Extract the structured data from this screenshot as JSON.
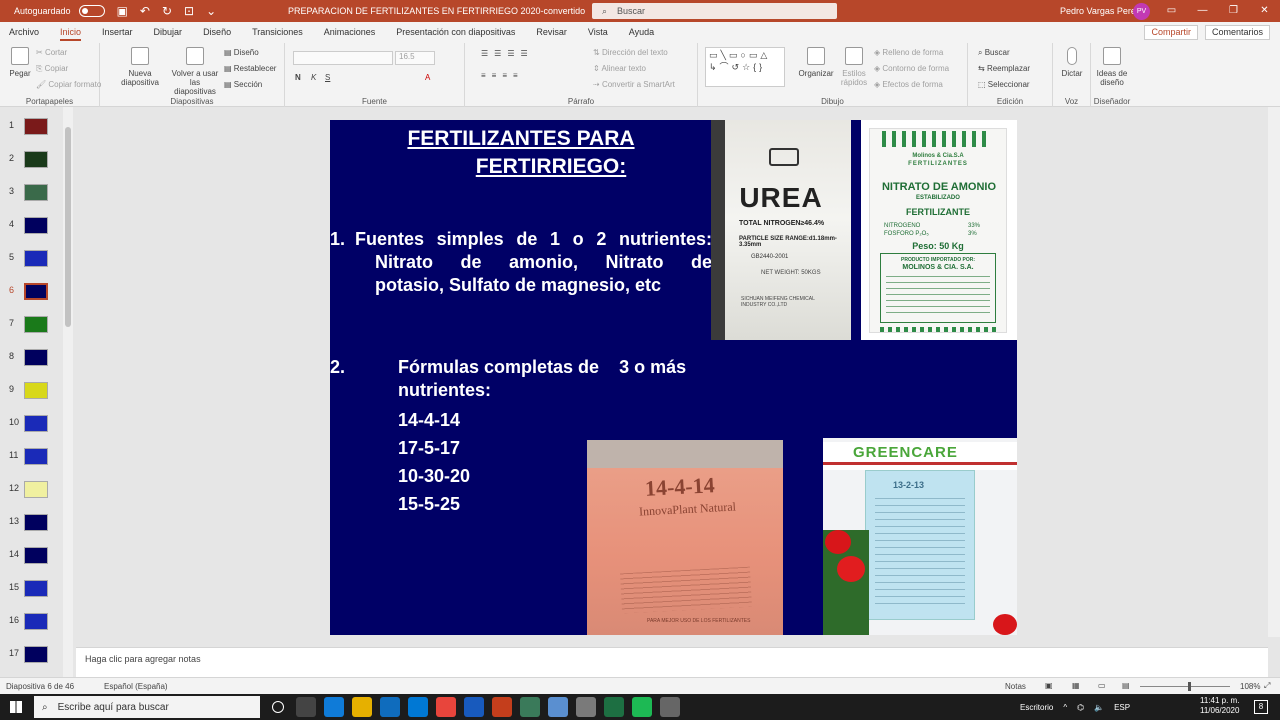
{
  "titlebar": {
    "autosave_label": "Autoguardado",
    "document_title": "PREPARACION DE FERTILIZANTES EN FERTIRRIEGO 2020-convertido",
    "search_placeholder": "Buscar",
    "user_name": "Pedro Vargas Perez",
    "user_initials": "PV"
  },
  "menu": {
    "tabs": [
      "Archivo",
      "Inicio",
      "Insertar",
      "Dibujar",
      "Diseño",
      "Transiciones",
      "Animaciones",
      "Presentación con diapositivas",
      "Revisar",
      "Vista",
      "Ayuda"
    ],
    "active": "Inicio",
    "share_label": "Compartir",
    "comments_label": "Comentarios"
  },
  "ribbon": {
    "portapapeles": {
      "label": "Portapapeles",
      "pegar": "Pegar",
      "cortar": "Cortar",
      "copiar": "Copiar",
      "copiar_formato": "Copiar formato"
    },
    "diapositivas": {
      "label": "Diapositivas",
      "nueva": "Nueva diapositiva",
      "volver": "Volver a usar las diapositivas",
      "diseno": "Diseño",
      "restablecer": "Restablecer",
      "seccion": "Sección"
    },
    "fuente": {
      "label": "Fuente",
      "size": "16.5",
      "n": "N",
      "k": "K",
      "s": "S"
    },
    "parrafo": {
      "label": "Párrafo",
      "direccion": "Dirección del texto",
      "alinear": "Alinear texto",
      "smartart": "Convertir a SmartArt"
    },
    "dibujo": {
      "label": "Dibujo",
      "organizar": "Organizar",
      "estilos": "Estilos rápidos",
      "relleno": "Relleno de forma",
      "contorno": "Contorno de forma",
      "efectos": "Efectos de forma"
    },
    "edicion": {
      "label": "Edición",
      "buscar": "Buscar",
      "reemplazar": "Reemplazar",
      "seleccionar": "Seleccionar"
    },
    "voz": {
      "label": "Voz",
      "dictar": "Dictar"
    },
    "disenador": {
      "label": "Diseñador",
      "ideas": "Ideas de diseño"
    }
  },
  "thumbnails": [
    "1",
    "2",
    "3",
    "4",
    "5",
    "6",
    "7",
    "8",
    "9",
    "10",
    "11",
    "12",
    "13",
    "14",
    "15",
    "16",
    "17"
  ],
  "selected_slide": "6",
  "slide": {
    "title_line1": "FERTILIZANTES PARA",
    "title_line2": "FERTIRRIEGO:",
    "item1_num": "1.",
    "item1_line1": "Fuentes simples de 1 o 2 nutrientes:",
    "item1_line2": "Nitrato de amonio, Nitrato de",
    "item1_line3": "potasio, Sulfato de magnesio, etc",
    "item2_num": "2.",
    "item2_text": "Fórmulas completas de    3 o más nutrientes:",
    "formulas": [
      "14-4-14",
      "17-5-17",
      "10-30-20",
      "15-5-25"
    ],
    "urea_bag": {
      "word": "UREA",
      "total": "TOTAL NITROGEN≥46.4%",
      "particle": "PARTICLE SIZE RANGE:d1.18mm-3.35mm",
      "gb": "GB2440-2001",
      "net": "NET WEIGHT: 50KGS",
      "maker": "SICHUAN MEIFENG CHEMICAL INDUSTRY CO.,LTD"
    },
    "nitrato_bag": {
      "brand": "Molinos & Cia.S.A",
      "brand2": "FERTILIZANTES",
      "name": "NITRATO DE AMONIO",
      "estab": "ESTABILIZADO",
      "fert": "FERTILIZANTE",
      "nitrogeno": "NITROGENO",
      "nitrogeno_val": "33%",
      "fosforo": "FOSFORO P₂O₅",
      "fosforo_val": "3%",
      "peso": "Peso: 50 Kg",
      "importado": "PRODUCTO IMPORTADO POR:",
      "molinos": "MOLINOS & CIA. S.A."
    },
    "bag_1444": {
      "num": "14-4-14",
      "brand": "InnovaPlant Natural",
      "foot": "PARA MEJOR USO DE LOS FERTILIZANTES"
    },
    "greencare_bag": {
      "logo": "GREENCARE",
      "formula": "13-2-13"
    }
  },
  "notes_placeholder": "Haga clic para agregar notas",
  "status": {
    "slide_pos": "Diapositiva 6 de 46",
    "language": "Español (España)",
    "notas": "Notas",
    "zoom": "108%"
  },
  "taskbar": {
    "search_placeholder": "Escribe aquí para buscar",
    "desktop_label": "Escritorio",
    "lang": "ESP",
    "time": "11:41 p. m.",
    "date": "11/06/2020",
    "notif_count": "8"
  }
}
